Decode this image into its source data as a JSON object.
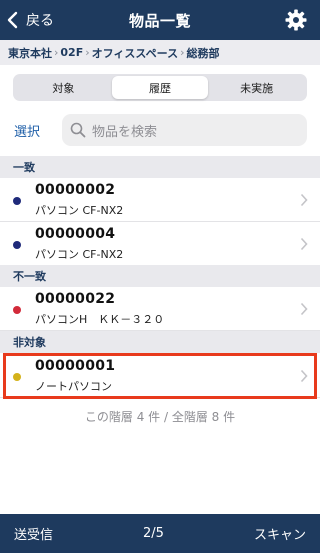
{
  "header": {
    "back_label": "戻る",
    "title": "物品一覧"
  },
  "breadcrumb": {
    "items": [
      "東京本社",
      "02F",
      "オフィススペース",
      "総務部"
    ]
  },
  "segments": [
    {
      "label": "対象"
    },
    {
      "label": "履歴"
    },
    {
      "label": "未実施"
    }
  ],
  "toolbar": {
    "select_label": "選択",
    "search_placeholder": "物品を検索"
  },
  "sections": [
    {
      "title": "一致",
      "items": [
        {
          "id": "00000002",
          "name": "パソコン CF-NX2",
          "dot_color": "#1f2a7a"
        },
        {
          "id": "00000004",
          "name": "パソコン CF-NX2",
          "dot_color": "#1f2a7a"
        }
      ]
    },
    {
      "title": "不一致",
      "items": [
        {
          "id": "00000022",
          "name": "パソコンH　ＫＫ－３２０",
          "dot_color": "#d22a3a"
        }
      ]
    },
    {
      "title": "非対象",
      "items": [
        {
          "id": "00000001",
          "name": "ノートパソコン",
          "dot_color": "#d4b21a"
        }
      ]
    }
  ],
  "count_text": "この階層 4 件 / 全階層 8 件",
  "bottom_bar": {
    "send_label": "送受信",
    "page": "2/5",
    "scan_label": "スキャン"
  },
  "colors": {
    "nav": "#1e3a5e",
    "highlight": "#e83a1c",
    "link": "#1f5fa8"
  }
}
